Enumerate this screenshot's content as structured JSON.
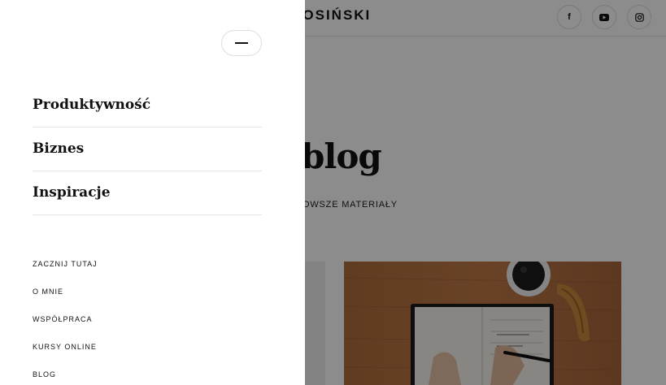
{
  "header": {
    "logo_text": "ŁOSIŃSKI",
    "social": [
      {
        "label": "f",
        "icon": "facebook-icon"
      },
      {
        "label": "",
        "icon": "youtube-icon"
      },
      {
        "label": "",
        "icon": "instagram-icon"
      }
    ]
  },
  "hero": {
    "title_fragment": "blog",
    "subtitle_fragment": "OWSZE MATERIAŁY"
  },
  "drawer": {
    "categories": [
      {
        "label": "Produktywność"
      },
      {
        "label": "Biznes"
      },
      {
        "label": "Inspiracje"
      }
    ],
    "links": [
      {
        "label": "ZACZNIJ TUTAJ"
      },
      {
        "label": "O MNIE"
      },
      {
        "label": "WSPÓŁPRACA"
      },
      {
        "label": "KURSY ONLINE"
      },
      {
        "label": "BLOG"
      }
    ]
  },
  "colors": {
    "overlay": "#000000",
    "text": "#111111",
    "wood": "#b5713f"
  }
}
